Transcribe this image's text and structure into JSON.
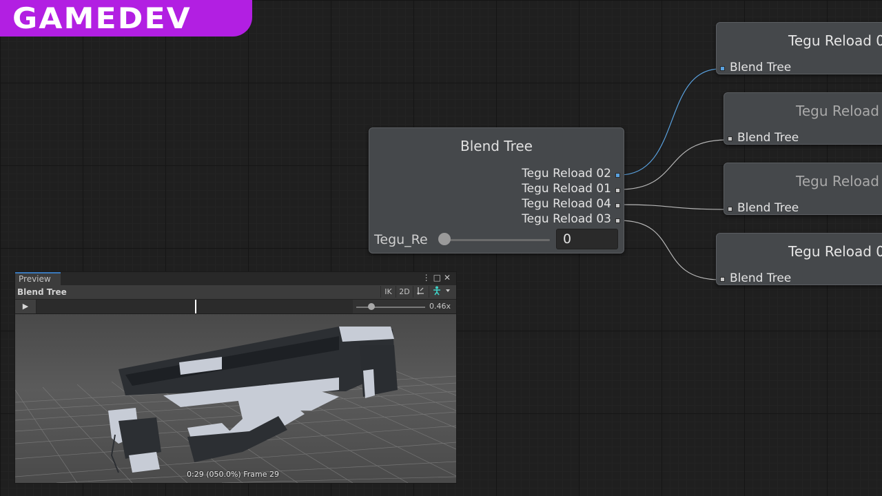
{
  "logo": {
    "text": "GAMEDEV"
  },
  "blend_node": {
    "title": "Blend Tree",
    "outputs": [
      "Tegu Reload 02",
      "Tegu Reload 01",
      "Tegu Reload 04",
      "Tegu Reload 03"
    ],
    "parameter": {
      "label": "Tegu_Re",
      "value": "0"
    }
  },
  "clip_nodes": [
    {
      "title": "Tegu Reload 0",
      "input": "Blend Tree"
    },
    {
      "title": "Tegu Reload",
      "input": "Blend Tree"
    },
    {
      "title": "Tegu Reload",
      "input": "Blend Tree"
    },
    {
      "title": "Tegu Reload 0",
      "input": "Blend Tree"
    }
  ],
  "preview": {
    "tab": "Preview",
    "title": "Blend Tree",
    "toolbar": {
      "ik": "IK",
      "mode": "2D"
    },
    "speed": "0.46x",
    "frame": "0:29 (050.0%) Frame 29"
  },
  "colors": {
    "logo_bg": "#b21fe2",
    "active_link": "#5aa2e0",
    "node_bg": "#45484b"
  }
}
